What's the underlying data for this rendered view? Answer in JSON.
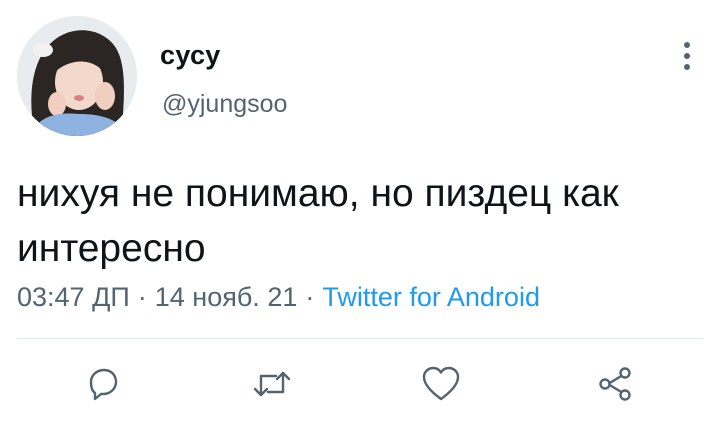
{
  "tweet": {
    "display_name": "сусу",
    "handle": "@yjungsoo",
    "text": "нихуя не понимаю, но пиздец как интересно",
    "time": "03:47 ДП",
    "date": "14 нояб. 21",
    "source": "Twitter for Android",
    "separator": "·"
  },
  "icons": {
    "more": "more-vertical-icon",
    "reply": "reply-icon",
    "retweet": "retweet-icon",
    "like": "heart-icon",
    "share": "share-icon"
  },
  "colors": {
    "text_primary": "#0f1419",
    "text_secondary": "#536471",
    "accent": "#1d9bf0",
    "divider": "#e1e8ed"
  }
}
